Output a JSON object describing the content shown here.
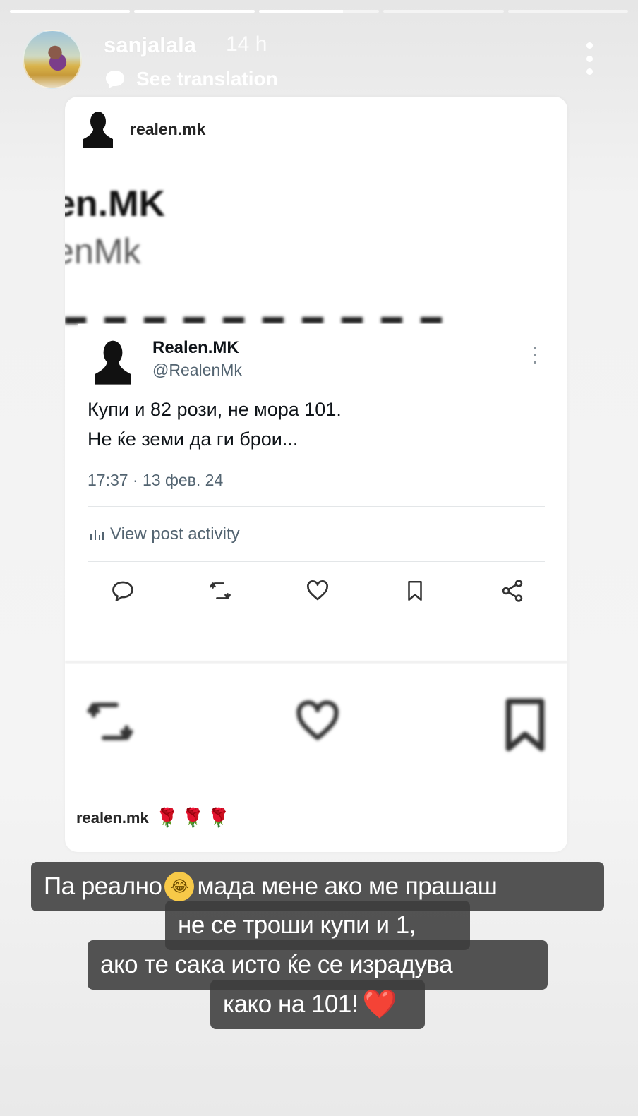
{
  "progress": {
    "segments": 5,
    "current_index": 2,
    "current_fill": 0.7
  },
  "header": {
    "username": "sanjalala",
    "time": "14 h",
    "translate_label": "See translation",
    "more_icon": "more-vertical-icon"
  },
  "card": {
    "username": "realen.mk",
    "blurred_name": "en.MK",
    "blurred_handle": "lenMk",
    "tweet": {
      "display_name": "Realen.MK",
      "handle": "@RealenMk",
      "body_line1": "Купи и 82 рози, не мора 101.",
      "body_line2": "Не ќе земи да ги брои...",
      "timestamp": "17:37 · 13 фев. 24",
      "activity_label": "View post activity",
      "actions": [
        "reply-icon",
        "retweet-icon",
        "like-icon",
        "bookmark-icon",
        "share-icon"
      ]
    },
    "caption_user": "realen.mk",
    "caption_emoji": "🌹🌹🌹"
  },
  "overlay": {
    "line1_a": "Па реално",
    "line1_emoji": "😂",
    "line1_b": "мада мене ако ме прашаш",
    "line2": "не се троши купи и 1,",
    "line3": "ако те сака исто ќе се израдува",
    "line4": "како на 101!",
    "line4_emoji": "❤️"
  },
  "colors": {
    "overlay_bg": "#3c3c3c",
    "text_dark": "#0f1419",
    "muted": "#536471",
    "heart": "#e0202b"
  }
}
